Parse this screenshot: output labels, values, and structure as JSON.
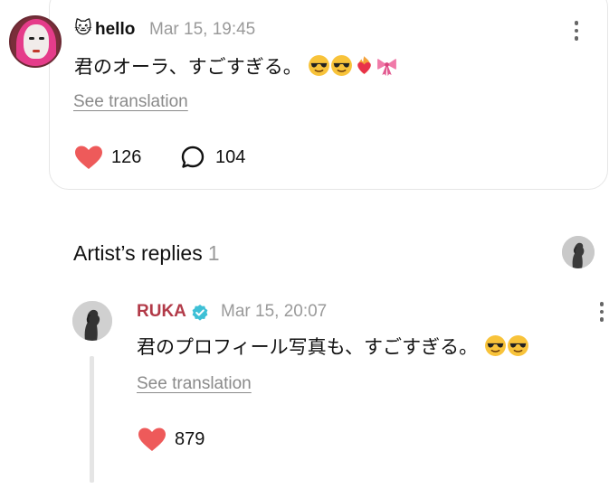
{
  "post": {
    "username": "hello",
    "username_emoji": "🐱",
    "timestamp": "Mar 15, 19:45",
    "text": "君のオーラ、すごすぎる。",
    "emojis": [
      "sunglasses-face",
      "sunglasses-face",
      "heart-on-fire",
      "ribbon"
    ],
    "see_translation": "See translation",
    "likes": "126",
    "comments": "104"
  },
  "section": {
    "title": "Artist’s replies",
    "count": "1"
  },
  "reply": {
    "username": "RUKA",
    "timestamp": "Mar 15, 20:07",
    "text": "君のプロフィール写真も、すごすぎる。",
    "emojis": [
      "sunglasses-face",
      "sunglasses-face"
    ],
    "see_translation": "See translation",
    "likes": "879"
  },
  "colors": {
    "heart": "#ee5a5a",
    "artist_name": "#b23a48",
    "verified": "#3ec0d6",
    "muted_text": "#9a9a9a"
  }
}
